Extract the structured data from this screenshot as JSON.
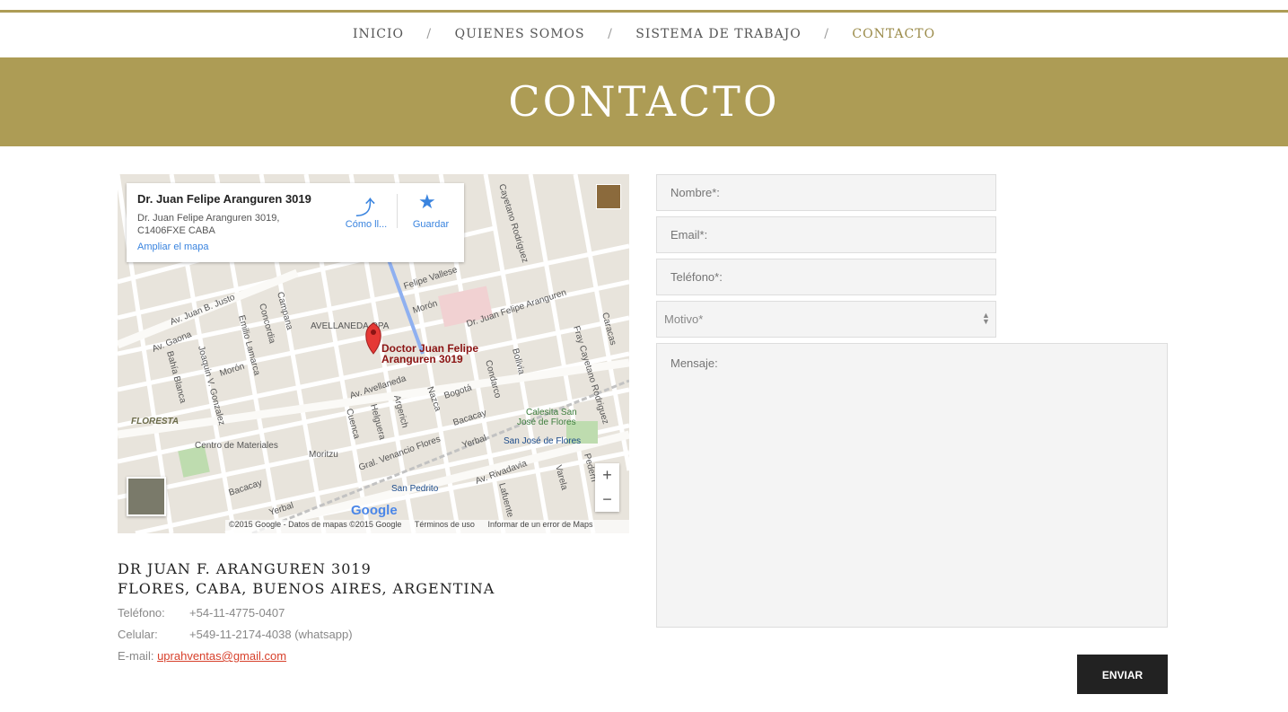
{
  "nav": {
    "items": [
      {
        "label": "INICIO"
      },
      {
        "label": "QUIENES SOMOS"
      },
      {
        "label": "SISTEMA DE TRABAJO"
      },
      {
        "label": "CONTACTO"
      }
    ],
    "separator": "/"
  },
  "banner": {
    "title": "CONTACTO"
  },
  "map": {
    "card": {
      "title": "Dr. Juan Felipe Aranguren 3019",
      "address_line1": "Dr. Juan Felipe Aranguren 3019,",
      "address_line2": "C1406FXE CABA",
      "enlarge_link": "Ampliar el mapa",
      "directions_label": "Cómo ll...",
      "save_label": "Guardar"
    },
    "marker_label_1": "Doctor Juan Felipe",
    "marker_label_2": "Aranguren 3019",
    "streets": {
      "av_avellaneda": "Av. Avellaneda",
      "av_rivadavia": "Av. Rivadavia",
      "av_gaona": "Av. Gaona",
      "av_juan_b_justo": "Av. Juan B. Justo",
      "felipe_vallese": "Felipe Vallese",
      "moron": "Morón",
      "moron2": "Morón",
      "aranguren": "Dr. Juan Felipe Aranguren",
      "nazca": "Nazca",
      "bogota": "Bogotá",
      "bacacay": "Bacacay",
      "bacacay2": "Bacacay",
      "yerbal": "Yerbal",
      "yerbal2": "Yerbal",
      "cuenca": "Cuenca",
      "helguera": "Helguera",
      "argerich": "Argerich",
      "condarco": "Condarco",
      "bolivia": "Bolivia",
      "caracas": "Caracas",
      "gral_venancio_flores": "Gral. Venancio Flores",
      "fray_cayetano": "Fray Cayetano Rodriguez",
      "cayetano_rodriguez": "Cayetano Rodriguez",
      "campana": "Campana",
      "concordia": "Concordia",
      "emilio_lamarca": "Emilio Lamarca",
      "joaquin_v_gonzalez": "Joaquin V. Gonzalez",
      "bahia_blanca": "Bahía Blanca",
      "varela": "Varela",
      "lafuente": "Lafuente",
      "pedernera": "Pedern"
    },
    "places": {
      "avellaneda_opa": "AVELLANEDA OPA",
      "floresta": "FLORESTA",
      "centro_materiales": "Centro de Materiales",
      "moritzu": "Moritzu",
      "calesita_1": "Calesita San",
      "calesita_2": "José de Flores",
      "san_jose_de_flores": "San José de Flores",
      "san_pedrito": "San Pedrito"
    },
    "zoom_in": "+",
    "zoom_out": "−",
    "brand": "Google",
    "credits": {
      "copyright": "©2015 Google - Datos de mapas ©2015 Google",
      "terms": "Términos de uso",
      "report": "Informar de un error de Maps"
    }
  },
  "address": {
    "line1": "DR JUAN F. ARANGUREN 3019",
    "line2": "FLORES, CABA, BUENOS AIRES, ARGENTINA"
  },
  "contact": {
    "phone_label": "Teléfono:",
    "phone_value": "+54-11-4775-0407",
    "mobile_label": "Celular:",
    "mobile_value": "+549-11-2174-4038 (whatsapp)",
    "email_label": "E-mail:",
    "email_value": "uprahventas@gmail.com"
  },
  "form": {
    "name_placeholder": "Nombre*:",
    "email_placeholder": "Email*:",
    "phone_placeholder": "Teléfono*:",
    "reason_selected": "Motivo*",
    "message_placeholder": "Mensaje:",
    "submit_label": "ENVIAR"
  },
  "colors": {
    "accent": "#ad9c55",
    "link": "#d7402b",
    "button": "#222222"
  }
}
